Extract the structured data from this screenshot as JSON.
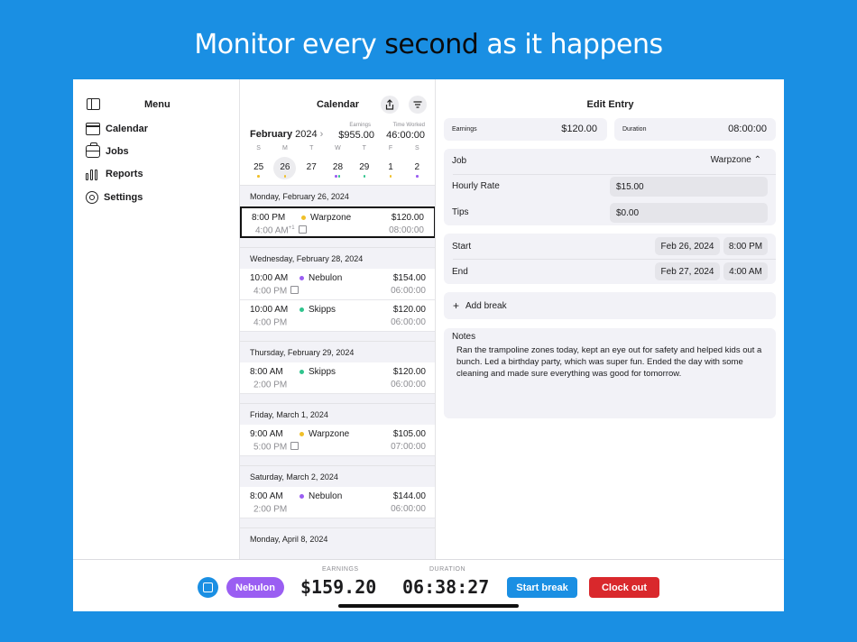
{
  "headline": {
    "pre": "Monitor every ",
    "em": "second",
    "post": " as it happens"
  },
  "sidebar": {
    "title": "Menu",
    "items": [
      {
        "label": "Calendar",
        "icon": "calendar-icon"
      },
      {
        "label": "Jobs",
        "icon": "briefcase-icon"
      },
      {
        "label": "Reports",
        "icon": "bar-chart-icon"
      },
      {
        "label": "Settings",
        "icon": "gear-icon"
      }
    ]
  },
  "calendar": {
    "title": "Calendar",
    "month": "February",
    "year": "2024",
    "earnings_label": "Earnings",
    "earnings": "$955.00",
    "time_label": "Time Worked",
    "time": "46:00:00",
    "weekdays": [
      "S",
      "M",
      "T",
      "W",
      "T",
      "F",
      "S"
    ],
    "days": [
      "25",
      "26",
      "27",
      "28",
      "29",
      "1",
      "2"
    ],
    "groups": [
      {
        "date": "Monday, February 26, 2024",
        "entries": [
          {
            "start": "8:00 PM",
            "job": "Warpzone",
            "pay": "$120.00",
            "end": "4:00 AM",
            "plus": "+1",
            "dur": "08:00:00",
            "color": "#f0c02a",
            "selected": true,
            "note": true
          }
        ]
      },
      {
        "date": "Wednesday, February 28, 2024",
        "entries": [
          {
            "start": "10:00 AM",
            "job": "Nebulon",
            "pay": "$154.00",
            "end": "4:00 PM",
            "plus": "",
            "dur": "06:00:00",
            "color": "#9a5ef2",
            "note": true
          },
          {
            "start": "10:00 AM",
            "job": "Skipps",
            "pay": "$120.00",
            "end": "4:00 PM",
            "plus": "",
            "dur": "06:00:00",
            "color": "#2fc48d"
          }
        ]
      },
      {
        "date": "Thursday, February 29, 2024",
        "entries": [
          {
            "start": "8:00 AM",
            "job": "Skipps",
            "pay": "$120.00",
            "end": "2:00 PM",
            "plus": "",
            "dur": "06:00:00",
            "color": "#2fc48d"
          }
        ]
      },
      {
        "date": "Friday, March 1, 2024",
        "entries": [
          {
            "start": "9:00 AM",
            "job": "Warpzone",
            "pay": "$105.00",
            "end": "5:00 PM",
            "plus": "",
            "dur": "07:00:00",
            "color": "#f0c02a",
            "note": true
          }
        ]
      },
      {
        "date": "Saturday, March 2, 2024",
        "entries": [
          {
            "start": "8:00 AM",
            "job": "Nebulon",
            "pay": "$144.00",
            "end": "2:00 PM",
            "plus": "",
            "dur": "06:00:00",
            "color": "#9a5ef2"
          }
        ]
      },
      {
        "date": "Monday, April 8, 2024",
        "entries": []
      }
    ]
  },
  "edit": {
    "title": "Edit Entry",
    "earnings_label": "Earnings",
    "earnings": "$120.00",
    "duration_label": "Duration",
    "duration": "08:00:00",
    "job_label": "Job",
    "job_value": "Warpzone",
    "rate_label": "Hourly Rate",
    "rate_value": "$15.00",
    "tips_label": "Tips",
    "tips_value": "$0.00",
    "start_label": "Start",
    "start_date": "Feb 26, 2024",
    "start_time": "8:00 PM",
    "end_label": "End",
    "end_date": "Feb 27, 2024",
    "end_time": "4:00 AM",
    "add_break": "Add break",
    "notes_label": "Notes",
    "notes": "Ran the trampoline zones today, kept an eye out for safety and helped kids out a bunch. Led a birthday party, which was super fun. Ended the day with some cleaning and made sure everything was good for tomorrow."
  },
  "bottom": {
    "job": "Nebulon",
    "earnings_label": "EARNINGS",
    "earnings": "$159.20",
    "duration_label": "DURATION",
    "duration": "06:38:27",
    "start_break": "Start break",
    "clock_out": "Clock out"
  },
  "colors": {
    "accent": "#1a8fe3",
    "nebulon": "#9a5ef2",
    "warpzone": "#f0c02a",
    "skipps": "#2fc48d",
    "clock_out": "#d9282c"
  }
}
